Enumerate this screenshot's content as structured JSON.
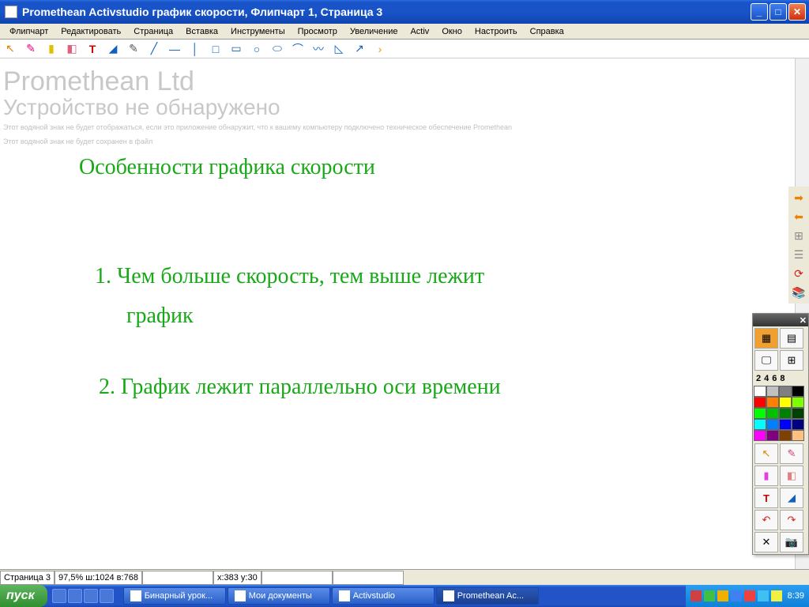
{
  "title": "Promethean Activstudio    график скорости,  Флипчарт 1,  Страница 3",
  "menu": [
    "Флипчарт",
    "Редактировать",
    "Страница",
    "Вставка",
    "Инструменты",
    "Просмотр",
    "Увеличение",
    "Activ",
    "Окно",
    "Настроить",
    "Справка"
  ],
  "watermark": {
    "company": "Promethean Ltd",
    "notfound": "Устройство не обнаружено",
    "note1": "Этот водяной знак не будет отображаться, если это приложение обнаружит, что к вашему компьютеру подключено техническое обеспечение Promethean",
    "note2": "Этот водяной знак не будет сохранен в файл"
  },
  "content": {
    "heading": "Особенности графика скорости",
    "item1a": "1. Чем больше скорость, тем выше лежит",
    "item1b": "график",
    "item2": "2. График лежит параллельно оси времени"
  },
  "palette": {
    "nums": [
      "2",
      "4",
      "6",
      "8"
    ],
    "colors": [
      "#ffffff",
      "#c0c0c0",
      "#808080",
      "#000000",
      "#ff0000",
      "#ff8000",
      "#ffff00",
      "#80ff00",
      "#00ff00",
      "#00c000",
      "#008000",
      "#004000",
      "#00ffff",
      "#0080ff",
      "#0000ff",
      "#000080",
      "#ff00ff",
      "#800080",
      "#804000",
      "#ffc080"
    ]
  },
  "status": {
    "page": "Страница 3",
    "zoom": "97,5%  ш:1024  в:768",
    "coords": "x:383  y:30"
  },
  "taskbar": {
    "start": "пуск",
    "tasks": [
      {
        "label": "Бинарный урок...",
        "active": false
      },
      {
        "label": "Мои документы",
        "active": false
      },
      {
        "label": "Activstudio",
        "active": false
      },
      {
        "label": "Promethean Ac...",
        "active": true
      }
    ],
    "clock": "8:39"
  }
}
